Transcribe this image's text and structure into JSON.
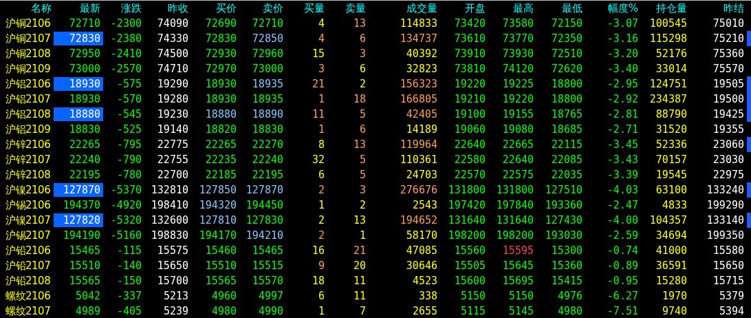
{
  "table": {
    "columns": [
      "名称",
      "最新",
      "涨跌",
      "昨收",
      "买价",
      "卖价",
      "买量",
      "卖量",
      "成交量",
      "开盘",
      "最高",
      "最低",
      "幅度%",
      "持仓量",
      "昨结"
    ],
    "rows": [
      {
        "highlighted": false,
        "marked": false,
        "cells": [
          {
            "text": "沪铜2106",
            "color": "#ffff00"
          },
          {
            "text": "72710"
          },
          {
            "text": "-2300",
            "color": "#00ff00"
          },
          {
            "text": "74090",
            "color": "#ffffff"
          },
          {
            "text": "72690",
            "color": "#00ff00"
          },
          {
            "text": "72710",
            "color": "#00ff00"
          },
          {
            "text": "4",
            "color": "#ffff00"
          },
          {
            "text": "13",
            "color": "#ff9c50"
          },
          {
            "text": "114833",
            "color": "#ffff00"
          },
          {
            "text": "73420",
            "color": "#00ff00"
          },
          {
            "text": "73580",
            "color": "#00ff00"
          },
          {
            "text": "72150",
            "color": "#00ff00"
          },
          {
            "text": "-3.07",
            "color": "#00ff00"
          },
          {
            "text": "100545",
            "color": "#ffff00"
          },
          {
            "text": "75010",
            "color": "#ffffff"
          }
        ]
      },
      {
        "highlighted": true,
        "marked": true,
        "cells": [
          {
            "text": "沪铜2107",
            "color": "#ffff00"
          },
          {
            "text": "72830"
          },
          {
            "text": "-2380",
            "color": "#00ff00"
          },
          {
            "text": "74330",
            "color": "#ffffff"
          },
          {
            "text": "72830",
            "color": "#00ff00"
          },
          {
            "text": "72850",
            "color": "#80c8ff"
          },
          {
            "text": "4",
            "color": "#ff9c50"
          },
          {
            "text": "6",
            "color": "#ff9c50"
          },
          {
            "text": "134737",
            "color": "#ff9c50"
          },
          {
            "text": "73610",
            "color": "#00ff00"
          },
          {
            "text": "73770",
            "color": "#00ff00"
          },
          {
            "text": "72350",
            "color": "#00ff00"
          },
          {
            "text": "-3.16",
            "color": "#00ff00"
          },
          {
            "text": "115298",
            "color": "#ffff00"
          },
          {
            "text": "75210",
            "color": "#ffffff"
          }
        ]
      },
      {
        "highlighted": false,
        "marked": false,
        "cells": [
          {
            "text": "沪铜2108",
            "color": "#ffff00"
          },
          {
            "text": "72950"
          },
          {
            "text": "-2410",
            "color": "#00ff00"
          },
          {
            "text": "74500",
            "color": "#ffffff"
          },
          {
            "text": "72930",
            "color": "#00ff00"
          },
          {
            "text": "72960",
            "color": "#00ff00"
          },
          {
            "text": "15",
            "color": "#ffff00"
          },
          {
            "text": "3",
            "color": "#ff9c50"
          },
          {
            "text": "40392",
            "color": "#ffff00"
          },
          {
            "text": "73910",
            "color": "#00ff00"
          },
          {
            "text": "73930",
            "color": "#00ff00"
          },
          {
            "text": "72510",
            "color": "#00ff00"
          },
          {
            "text": "-3.20",
            "color": "#00ff00"
          },
          {
            "text": "52176",
            "color": "#ffff00"
          },
          {
            "text": "75360",
            "color": "#ffffff"
          }
        ]
      },
      {
        "highlighted": false,
        "marked": false,
        "cells": [
          {
            "text": "沪铜2109",
            "color": "#ffff00"
          },
          {
            "text": "73000"
          },
          {
            "text": "-2570",
            "color": "#00ff00"
          },
          {
            "text": "74710",
            "color": "#ffffff"
          },
          {
            "text": "72970",
            "color": "#00ff00"
          },
          {
            "text": "73000",
            "color": "#00ff00"
          },
          {
            "text": "3",
            "color": "#ff9c50"
          },
          {
            "text": "6",
            "color": "#ffff00"
          },
          {
            "text": "32823",
            "color": "#ffff00"
          },
          {
            "text": "73810",
            "color": "#00ff00"
          },
          {
            "text": "74120",
            "color": "#00ff00"
          },
          {
            "text": "72620",
            "color": "#00ff00"
          },
          {
            "text": "-3.40",
            "color": "#00ff00"
          },
          {
            "text": "33014",
            "color": "#ffff00"
          },
          {
            "text": "75570",
            "color": "#ffffff"
          }
        ]
      },
      {
        "highlighted": true,
        "marked": true,
        "cells": [
          {
            "text": "沪铝2106",
            "color": "#ffff00"
          },
          {
            "text": "18930"
          },
          {
            "text": "-575",
            "color": "#00ff00"
          },
          {
            "text": "19290",
            "color": "#ffffff"
          },
          {
            "text": "18930",
            "color": "#00ff00"
          },
          {
            "text": "18935",
            "color": "#80c8ff"
          },
          {
            "text": "21",
            "color": "#ff9c50"
          },
          {
            "text": "2",
            "color": "#ffff00"
          },
          {
            "text": "156323",
            "color": "#ff9c50"
          },
          {
            "text": "19220",
            "color": "#00ff00"
          },
          {
            "text": "19225",
            "color": "#00ff00"
          },
          {
            "text": "18800",
            "color": "#00ff00"
          },
          {
            "text": "-2.95",
            "color": "#00ff00"
          },
          {
            "text": "124751",
            "color": "#ffff00"
          },
          {
            "text": "19505",
            "color": "#ffffff"
          }
        ]
      },
      {
        "highlighted": false,
        "marked": true,
        "cells": [
          {
            "text": "沪铝2107",
            "color": "#ffff00"
          },
          {
            "text": "18930"
          },
          {
            "text": "-570",
            "color": "#00ff00"
          },
          {
            "text": "19280",
            "color": "#ffffff"
          },
          {
            "text": "18930",
            "color": "#00ff00"
          },
          {
            "text": "18935",
            "color": "#00ff00"
          },
          {
            "text": "1",
            "color": "#ff9c50"
          },
          {
            "text": "18",
            "color": "#ff9c50"
          },
          {
            "text": "166805",
            "color": "#ff9c50"
          },
          {
            "text": "19210",
            "color": "#00ff00"
          },
          {
            "text": "19220",
            "color": "#00ff00"
          },
          {
            "text": "18800",
            "color": "#00ff00"
          },
          {
            "text": "-2.92",
            "color": "#00ff00"
          },
          {
            "text": "234387",
            "color": "#ffff00"
          },
          {
            "text": "19500",
            "color": "#ffffff"
          }
        ]
      },
      {
        "highlighted": true,
        "marked": true,
        "cells": [
          {
            "text": "沪铝2108",
            "color": "#ffff00"
          },
          {
            "text": "18880"
          },
          {
            "text": "-545",
            "color": "#00ff00"
          },
          {
            "text": "19230",
            "color": "#ffffff"
          },
          {
            "text": "18880",
            "color": "#80c8ff"
          },
          {
            "text": "18890",
            "color": "#80c8ff"
          },
          {
            "text": "11",
            "color": "#ff9c50"
          },
          {
            "text": "5",
            "color": "#ff9c50"
          },
          {
            "text": "42405",
            "color": "#ff9c50"
          },
          {
            "text": "19100",
            "color": "#00ff00"
          },
          {
            "text": "19155",
            "color": "#00ff00"
          },
          {
            "text": "18765",
            "color": "#00ff00"
          },
          {
            "text": "-2.81",
            "color": "#00ff00"
          },
          {
            "text": "88790",
            "color": "#ffff00"
          },
          {
            "text": "19425",
            "color": "#ffffff"
          }
        ]
      },
      {
        "highlighted": false,
        "marked": false,
        "cells": [
          {
            "text": "沪铝2109",
            "color": "#ffff00"
          },
          {
            "text": "18830"
          },
          {
            "text": "-525",
            "color": "#00ff00"
          },
          {
            "text": "19140",
            "color": "#ffffff"
          },
          {
            "text": "18820",
            "color": "#00ff00"
          },
          {
            "text": "18830",
            "color": "#00ff00"
          },
          {
            "text": "1",
            "color": "#ff9c50"
          },
          {
            "text": "6",
            "color": "#ff9c50"
          },
          {
            "text": "14189",
            "color": "#ffff00"
          },
          {
            "text": "19060",
            "color": "#00ff00"
          },
          {
            "text": "19080",
            "color": "#00ff00"
          },
          {
            "text": "18685",
            "color": "#00ff00"
          },
          {
            "text": "-2.71",
            "color": "#00ff00"
          },
          {
            "text": "31520",
            "color": "#ffff00"
          },
          {
            "text": "19355",
            "color": "#ffffff"
          }
        ]
      },
      {
        "highlighted": false,
        "marked": true,
        "cells": [
          {
            "text": "沪锌2106",
            "color": "#ffff00"
          },
          {
            "text": "22265"
          },
          {
            "text": "-795",
            "color": "#00ff00"
          },
          {
            "text": "22775",
            "color": "#ffffff"
          },
          {
            "text": "22265",
            "color": "#00ff00"
          },
          {
            "text": "22270",
            "color": "#00ff00"
          },
          {
            "text": "8",
            "color": "#ffff00"
          },
          {
            "text": "13",
            "color": "#ff9c50"
          },
          {
            "text": "119964",
            "color": "#ff9c50"
          },
          {
            "text": "22640",
            "color": "#00ff00"
          },
          {
            "text": "22665",
            "color": "#00ff00"
          },
          {
            "text": "22115",
            "color": "#00ff00"
          },
          {
            "text": "-3.45",
            "color": "#00ff00"
          },
          {
            "text": "52336",
            "color": "#ffff00"
          },
          {
            "text": "23060",
            "color": "#ffffff"
          }
        ]
      },
      {
        "highlighted": false,
        "marked": false,
        "cells": [
          {
            "text": "沪锌2107",
            "color": "#ffff00"
          },
          {
            "text": "22240"
          },
          {
            "text": "-790",
            "color": "#00ff00"
          },
          {
            "text": "22755",
            "color": "#ffffff"
          },
          {
            "text": "22235",
            "color": "#00ff00"
          },
          {
            "text": "22240",
            "color": "#00ff00"
          },
          {
            "text": "32",
            "color": "#ffff00"
          },
          {
            "text": "5",
            "color": "#ff9c50"
          },
          {
            "text": "110361",
            "color": "#ffff00"
          },
          {
            "text": "22580",
            "color": "#00ff00"
          },
          {
            "text": "22640",
            "color": "#00ff00"
          },
          {
            "text": "22085",
            "color": "#00ff00"
          },
          {
            "text": "-3.43",
            "color": "#00ff00"
          },
          {
            "text": "70157",
            "color": "#ffff00"
          },
          {
            "text": "23030",
            "color": "#ffffff"
          }
        ]
      },
      {
        "highlighted": false,
        "marked": false,
        "cells": [
          {
            "text": "沪锌2108",
            "color": "#ffff00"
          },
          {
            "text": "22195"
          },
          {
            "text": "-780",
            "color": "#00ff00"
          },
          {
            "text": "22700",
            "color": "#ffffff"
          },
          {
            "text": "22185",
            "color": "#00ff00"
          },
          {
            "text": "22195",
            "color": "#00ff00"
          },
          {
            "text": "6",
            "color": "#ffff00"
          },
          {
            "text": "5",
            "color": "#ff9c50"
          },
          {
            "text": "24703",
            "color": "#ffff00"
          },
          {
            "text": "22570",
            "color": "#00ff00"
          },
          {
            "text": "22575",
            "color": "#00ff00"
          },
          {
            "text": "22035",
            "color": "#00ff00"
          },
          {
            "text": "-3.39",
            "color": "#00ff00"
          },
          {
            "text": "19545",
            "color": "#ffff00"
          },
          {
            "text": "22975",
            "color": "#ffffff"
          }
        ]
      },
      {
        "highlighted": true,
        "marked": true,
        "cells": [
          {
            "text": "沪镍2106",
            "color": "#ffff00"
          },
          {
            "text": "127870"
          },
          {
            "text": "-5370",
            "color": "#00ff00"
          },
          {
            "text": "132810",
            "color": "#ffffff"
          },
          {
            "text": "127850",
            "color": "#80c8ff"
          },
          {
            "text": "127870",
            "color": "#80c8ff"
          },
          {
            "text": "2",
            "color": "#ff9c50"
          },
          {
            "text": "3",
            "color": "#ff9c50"
          },
          {
            "text": "276676",
            "color": "#ff9c50"
          },
          {
            "text": "131800",
            "color": "#00ff00"
          },
          {
            "text": "131800",
            "color": "#00ff00"
          },
          {
            "text": "127510",
            "color": "#00ff00"
          },
          {
            "text": "-4.03",
            "color": "#00ff00"
          },
          {
            "text": "63100",
            "color": "#ffff00"
          },
          {
            "text": "133240",
            "color": "#ffffff"
          }
        ]
      },
      {
        "highlighted": false,
        "marked": false,
        "cells": [
          {
            "text": "沪锡2106",
            "color": "#ffff00"
          },
          {
            "text": "194370"
          },
          {
            "text": "-4920",
            "color": "#00ff00"
          },
          {
            "text": "198410",
            "color": "#ffffff"
          },
          {
            "text": "194320",
            "color": "#80c8ff"
          },
          {
            "text": "194450",
            "color": "#00ff00"
          },
          {
            "text": "1",
            "color": "#ffff00"
          },
          {
            "text": "2",
            "color": "#ffff00"
          },
          {
            "text": "2543",
            "color": "#ffff00"
          },
          {
            "text": "197420",
            "color": "#00ff00"
          },
          {
            "text": "197840",
            "color": "#00ff00"
          },
          {
            "text": "193360",
            "color": "#00ff00"
          },
          {
            "text": "-2.47",
            "color": "#00ff00"
          },
          {
            "text": "4833",
            "color": "#ffff00"
          },
          {
            "text": "199290",
            "color": "#ffffff"
          }
        ]
      },
      {
        "highlighted": true,
        "marked": true,
        "cells": [
          {
            "text": "沪镍2107",
            "color": "#ffff00"
          },
          {
            "text": "127820"
          },
          {
            "text": "-5320",
            "color": "#00ff00"
          },
          {
            "text": "132600",
            "color": "#ffffff"
          },
          {
            "text": "127810",
            "color": "#80c8ff"
          },
          {
            "text": "127830",
            "color": "#00ff00"
          },
          {
            "text": "2",
            "color": "#ffff00"
          },
          {
            "text": "13",
            "color": "#ffff00"
          },
          {
            "text": "194652",
            "color": "#ff9c50"
          },
          {
            "text": "131640",
            "color": "#00ff00"
          },
          {
            "text": "131640",
            "color": "#00ff00"
          },
          {
            "text": "127430",
            "color": "#00ff00"
          },
          {
            "text": "-4.00",
            "color": "#00ff00"
          },
          {
            "text": "104357",
            "color": "#ffff00"
          },
          {
            "text": "133140",
            "color": "#ffffff"
          }
        ]
      },
      {
        "highlighted": false,
        "marked": false,
        "cells": [
          {
            "text": "沪锡2107",
            "color": "#ffff00"
          },
          {
            "text": "194190"
          },
          {
            "text": "-5160",
            "color": "#00ff00"
          },
          {
            "text": "198830",
            "color": "#ffffff"
          },
          {
            "text": "194170",
            "color": "#00ff00"
          },
          {
            "text": "194210",
            "color": "#80c8ff"
          },
          {
            "text": "2",
            "color": "#ff9c50"
          },
          {
            "text": "1",
            "color": "#ffff00"
          },
          {
            "text": "58170",
            "color": "#ffff00"
          },
          {
            "text": "198200",
            "color": "#00ff00"
          },
          {
            "text": "198200",
            "color": "#00ff00"
          },
          {
            "text": "193030",
            "color": "#00ff00"
          },
          {
            "text": "-2.59",
            "color": "#00ff00"
          },
          {
            "text": "34694",
            "color": "#ffff00"
          },
          {
            "text": "199350",
            "color": "#ffffff"
          }
        ]
      },
      {
        "highlighted": false,
        "marked": false,
        "cells": [
          {
            "text": "沪铅2106",
            "color": "#ffff00"
          },
          {
            "text": "15465"
          },
          {
            "text": "-115",
            "color": "#00ff00"
          },
          {
            "text": "15575",
            "color": "#ffffff"
          },
          {
            "text": "15460",
            "color": "#00ff00"
          },
          {
            "text": "15465",
            "color": "#00ff00"
          },
          {
            "text": "16",
            "color": "#ffff00"
          },
          {
            "text": "21",
            "color": "#ff9c50"
          },
          {
            "text": "47085",
            "color": "#ffff00"
          },
          {
            "text": "15560",
            "color": "#00ff00"
          },
          {
            "text": "15595",
            "color": "#ff4040"
          },
          {
            "text": "15300",
            "color": "#00ff00"
          },
          {
            "text": "-0.74",
            "color": "#00ff00"
          },
          {
            "text": "41000",
            "color": "#ffff00"
          },
          {
            "text": "15580",
            "color": "#ffffff"
          }
        ]
      },
      {
        "highlighted": false,
        "marked": false,
        "cells": [
          {
            "text": "沪铅2107",
            "color": "#ffff00"
          },
          {
            "text": "15510"
          },
          {
            "text": "-140",
            "color": "#00ff00"
          },
          {
            "text": "15650",
            "color": "#ffffff"
          },
          {
            "text": "15510",
            "color": "#00ff00"
          },
          {
            "text": "15515",
            "color": "#00ff00"
          },
          {
            "text": "9",
            "color": "#ff9c50"
          },
          {
            "text": "20",
            "color": "#ffff00"
          },
          {
            "text": "30646",
            "color": "#ffff00"
          },
          {
            "text": "15505",
            "color": "#00ff00"
          },
          {
            "text": "15645",
            "color": "#00ff00"
          },
          {
            "text": "15360",
            "color": "#00ff00"
          },
          {
            "text": "-0.89",
            "color": "#00ff00"
          },
          {
            "text": "36591",
            "color": "#ffff00"
          },
          {
            "text": "15650",
            "color": "#ffffff"
          }
        ]
      },
      {
        "highlighted": false,
        "marked": false,
        "cells": [
          {
            "text": "沪铅2108",
            "color": "#ffff00"
          },
          {
            "text": "15565"
          },
          {
            "text": "-150",
            "color": "#00ff00"
          },
          {
            "text": "15700",
            "color": "#ffffff"
          },
          {
            "text": "15565",
            "color": "#00ff00"
          },
          {
            "text": "15570",
            "color": "#00ff00"
          },
          {
            "text": "18",
            "color": "#ffff00"
          },
          {
            "text": "11",
            "color": "#ffff00"
          },
          {
            "text": "4523",
            "color": "#ffff00"
          },
          {
            "text": "15600",
            "color": "#00ff00"
          },
          {
            "text": "15695",
            "color": "#00ff00"
          },
          {
            "text": "15415",
            "color": "#00ff00"
          },
          {
            "text": "-0.95",
            "color": "#00ff00"
          },
          {
            "text": "15280",
            "color": "#ffff00"
          },
          {
            "text": "15715",
            "color": "#ffffff"
          }
        ]
      },
      {
        "highlighted": false,
        "marked": false,
        "cells": [
          {
            "text": "螺纹2106",
            "color": "#ffff00"
          },
          {
            "text": "5042"
          },
          {
            "text": "-337",
            "color": "#00ff00"
          },
          {
            "text": "5213",
            "color": "#ffffff"
          },
          {
            "text": "4960",
            "color": "#00ff00"
          },
          {
            "text": "4997",
            "color": "#00ff00"
          },
          {
            "text": "6",
            "color": "#ffff00"
          },
          {
            "text": "11",
            "color": "#ffff00"
          },
          {
            "text": "338",
            "color": "#ffff00"
          },
          {
            "text": "5150",
            "color": "#00ff00"
          },
          {
            "text": "5150",
            "color": "#00ff00"
          },
          {
            "text": "4976",
            "color": "#00ff00"
          },
          {
            "text": "-6.27",
            "color": "#00ff00"
          },
          {
            "text": "1970",
            "color": "#ffff00"
          },
          {
            "text": "5379",
            "color": "#ffffff"
          }
        ]
      },
      {
        "highlighted": false,
        "marked": false,
        "cells": [
          {
            "text": "螺纹2107",
            "color": "#ffff00"
          },
          {
            "text": "4989"
          },
          {
            "text": "-405",
            "color": "#00ff00"
          },
          {
            "text": "5239",
            "color": "#ffffff"
          },
          {
            "text": "4980",
            "color": "#00ff00"
          },
          {
            "text": "4990",
            "color": "#00ff00"
          },
          {
            "text": "1",
            "color": "#ffff00"
          },
          {
            "text": "7",
            "color": "#ffff00"
          },
          {
            "text": "2655",
            "color": "#ffff00"
          },
          {
            "text": "5115",
            "color": "#00ff00"
          },
          {
            "text": "5145",
            "color": "#00ff00"
          },
          {
            "text": "4980",
            "color": "#00ff00"
          },
          {
            "text": "-7.51",
            "color": "#00ff00"
          },
          {
            "text": "9740",
            "color": "#ffff00"
          },
          {
            "text": "5394",
            "color": "#ffffff"
          }
        ]
      }
    ]
  }
}
